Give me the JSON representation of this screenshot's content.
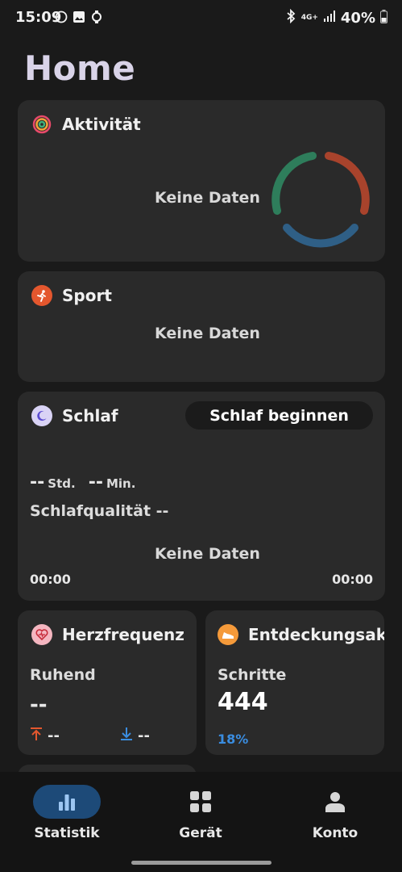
{
  "status_bar": {
    "time": "15:09",
    "network": "4G+",
    "battery": "40%"
  },
  "page": {
    "title": "Home"
  },
  "activity": {
    "title": "Aktivität",
    "no_data": "Keine Daten"
  },
  "sport": {
    "title": "Sport",
    "no_data": "Keine Daten"
  },
  "sleep": {
    "title": "Schlaf",
    "start_button": "Schlaf beginnen",
    "hours_value": "--",
    "hours_unit": "Std.",
    "minutes_value": "--",
    "minutes_unit": "Min.",
    "quality": "Schlafqualität --",
    "no_data": "Keine Daten",
    "start_time": "00:00",
    "end_time": "00:00"
  },
  "heart_rate": {
    "title": "Herzfrequenz",
    "resting_label": "Ruhend",
    "resting_value": "--",
    "max_value": "--",
    "min_value": "--"
  },
  "discovery": {
    "title": "Entdeckungsaktiv",
    "steps_label": "Schritte",
    "steps_value": "444",
    "percent": "18%"
  },
  "nav": {
    "statistik": "Statistik",
    "geraet": "Gerät",
    "konto": "Konto"
  },
  "colors": {
    "ring_green": "#2e7d5b",
    "ring_red": "#a8432c",
    "ring_blue": "#2f5f86",
    "sport_orange": "#e4572e",
    "heart_pink": "#f4b6c0",
    "discovery_orange": "#f59a3a",
    "accent_blue": "#3a8de0",
    "nav_active_bg": "#1d4a78"
  }
}
